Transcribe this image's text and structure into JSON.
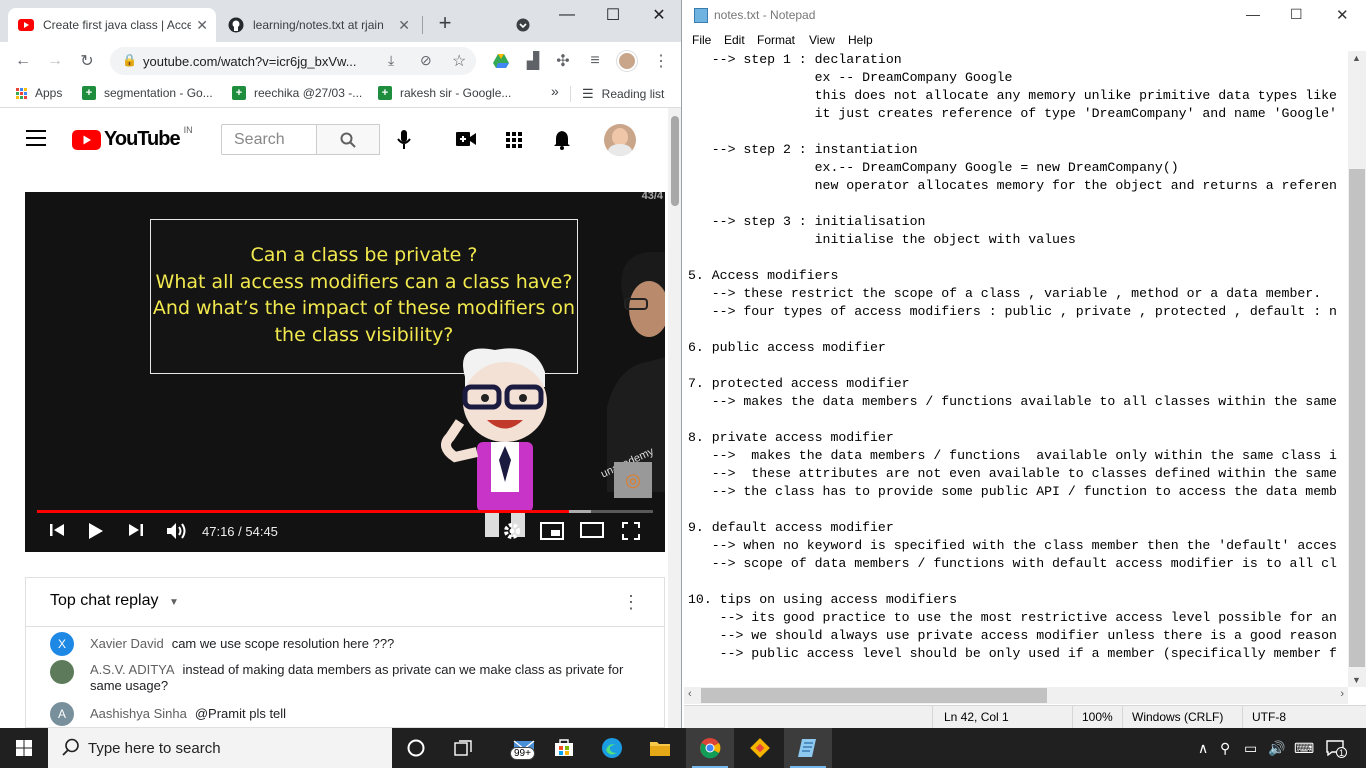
{
  "browser": {
    "tabs": [
      {
        "title": "Create first java class | Acce",
        "active": true
      },
      {
        "title": "learning/notes.txt at rjain",
        "active": false
      }
    ],
    "url": "youtube.com/watch?v=icr6jg_bxVw...",
    "bookmarks": [
      {
        "label": "Apps"
      },
      {
        "label": "segmentation - Go..."
      },
      {
        "label": "reechika @27/03 -..."
      },
      {
        "label": "rakesh sir - Google..."
      }
    ],
    "reading_list": "Reading list",
    "overflow": "»"
  },
  "youtube": {
    "logo_text": "YouTube",
    "region": "IN",
    "search_placeholder": "Search",
    "video": {
      "counter": "43/4",
      "slide_lines": [
        "Can a class be private ?",
        "What all access modifiers can a class have?",
        "And what’s the impact of these modifiers on",
        "the class visibility?"
      ],
      "watermark": "unacademy",
      "timecode": "47:16 / 54:45",
      "played_fraction": 0.864,
      "loaded_fraction": 0.9
    },
    "chat": {
      "title": "Top chat replay",
      "messages": [
        {
          "initial": "X",
          "author": "Xavier David",
          "text": "cam we use scope resolution here ???",
          "color": "#1e88e5"
        },
        {
          "initial": "",
          "author": "A.S.V. ADITYA",
          "text": "instead of making data members as private can we make class as private for same usage?",
          "color": "#5d7a5a"
        },
        {
          "initial": "A",
          "author": "Aashishya Sinha",
          "text": "@Pramit pls tell",
          "color": "#78909c"
        }
      ]
    }
  },
  "notepad": {
    "title": "notes.txt - Notepad",
    "menu": [
      "File",
      "Edit",
      "Format",
      "View",
      "Help"
    ],
    "lines": [
      "   --> step 1 : declaration",
      "                ex -- DreamCompany Google",
      "                this does not allocate any memory unlike primitive data types like",
      "                it just creates reference of type 'DreamCompany' and name 'Google'",
      "",
      "   --> step 2 : instantiation",
      "                ex.-- DreamCompany Google = new DreamCompany()",
      "                new operator allocates memory for the object and returns a referen",
      "",
      "   --> step 3 : initialisation",
      "                initialise the object with values",
      "",
      "5. Access modifiers",
      "   --> these restrict the scope of a class , variable , method or a data member.",
      "   --> four types of access modifiers : public , private , protected , default : n",
      "",
      "6. public access modifier",
      "",
      "7. protected access modifier",
      "   --> makes the data members / functions available to all classes within the same",
      "",
      "8. private access modifier",
      "   -->  makes the data members / functions  available only within the same class i",
      "   -->  these attributes are not even available to classes defined within the same",
      "   --> the class has to provide some public API / function to access the data memb",
      "",
      "9. default access modifier",
      "   --> when no keyword is specified with the class member then the 'default' acces",
      "   --> scope of data members / functions with default access modifier is to all cl",
      "",
      "10. tips on using access modifiers",
      "    --> its good practice to use the most restrictive access level possible for an",
      "    --> we should always use private access modifier unless there is a good reason",
      "    --> public access level should be only used if a member (specifically member f"
    ],
    "status": {
      "position": "Ln 42, Col 1",
      "zoom": "100%",
      "line_ending": "Windows (CRLF)",
      "encoding": "UTF-8"
    }
  },
  "taskbar": {
    "search_placeholder": "Type here to search",
    "mail_badge": "99+",
    "notification_count": "1"
  }
}
